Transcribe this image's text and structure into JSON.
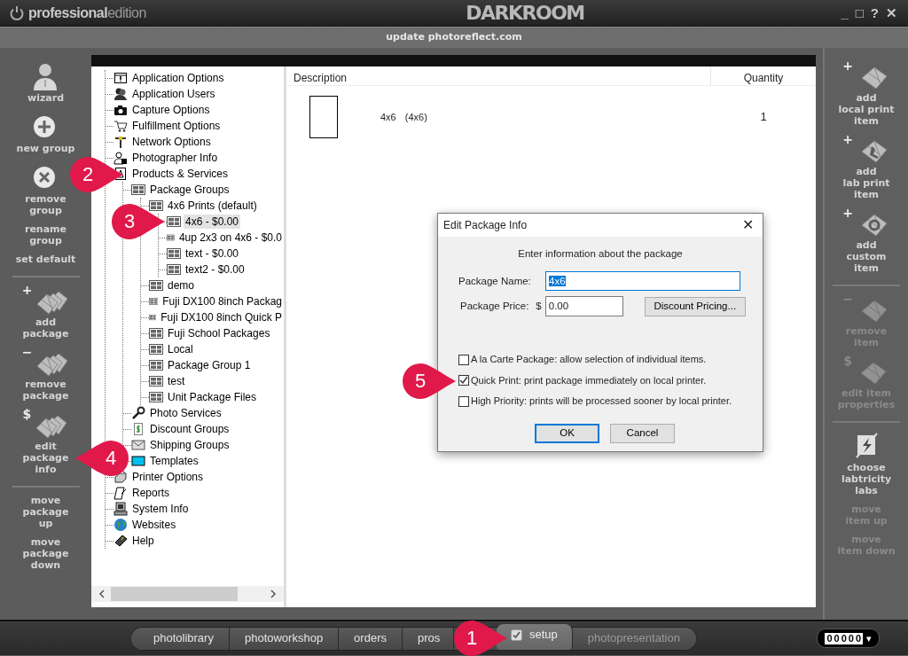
{
  "window": {
    "brand": "professional",
    "edition": "edition",
    "title": "DARKROOM",
    "controls": [
      "_",
      "□",
      "?",
      "✕"
    ]
  },
  "update_bar": {
    "text": "update photoreflect.com"
  },
  "left_toolbar": {
    "groups": [
      [
        {
          "label": "wizard",
          "disabled": false
        },
        {
          "label": "new group",
          "disabled": false
        },
        {
          "label": "remove\ngroup",
          "disabled": false
        },
        {
          "label": "rename\ngroup",
          "disabled": false
        },
        {
          "label": "set default",
          "disabled": false
        }
      ],
      [
        {
          "label": "add\npackage",
          "badge": "+",
          "disabled": false
        },
        {
          "label": "remove\npackage",
          "badge": "−",
          "disabled": false
        },
        {
          "label": "edit\npackage\ninfo",
          "badge": "$",
          "disabled": false
        }
      ],
      [
        {
          "label": "move\npackage\nup",
          "disabled": false
        },
        {
          "label": "move\npackage\ndown",
          "disabled": false
        }
      ]
    ]
  },
  "tree": [
    {
      "label": "Application Options",
      "selected": false
    },
    {
      "label": "Application Users",
      "selected": false
    },
    {
      "label": "Capture Options",
      "selected": false
    },
    {
      "label": "Fulfillment Options",
      "selected": false
    },
    {
      "label": "Network Options",
      "selected": false
    },
    {
      "label": "Photographer Info",
      "selected": false
    },
    {
      "label": "Products & Services",
      "selected": false,
      "children": [
        {
          "label": "Package Groups",
          "selected": false,
          "children": [
            {
              "label": "4x6 Prints (default)",
              "selected": false,
              "children": [
                {
                  "label": "4x6 - $0.00",
                  "selected": true
                },
                {
                  "label": "4up 2x3 on 4x6 - $0.0",
                  "selected": false
                },
                {
                  "label": "text - $0.00",
                  "selected": false
                },
                {
                  "label": "text2 - $0.00",
                  "selected": false
                }
              ]
            },
            {
              "label": "demo",
              "selected": false
            },
            {
              "label": "Fuji DX100 8inch Packag",
              "selected": false
            },
            {
              "label": "Fuji DX100 8inch Quick P",
              "selected": false
            },
            {
              "label": "Fuji School Packages",
              "selected": false
            },
            {
              "label": "Local",
              "selected": false
            },
            {
              "label": "Package Group 1",
              "selected": false
            },
            {
              "label": "test",
              "selected": false
            },
            {
              "label": "Unit Package Files",
              "selected": false
            }
          ]
        },
        {
          "label": "Photo Services",
          "selected": false
        },
        {
          "label": "Discount Groups",
          "selected": false
        },
        {
          "label": "Shipping Groups",
          "selected": false
        },
        {
          "label": "Templates",
          "selected": false
        }
      ]
    },
    {
      "label": "Printer Options",
      "selected": false
    },
    {
      "label": "Reports",
      "selected": false
    },
    {
      "label": "System Info",
      "selected": false
    },
    {
      "label": "Websites",
      "selected": false
    },
    {
      "label": "Help",
      "selected": false
    }
  ],
  "table": {
    "columns": [
      "Description",
      "Quantity"
    ],
    "rows": [
      {
        "name": "4x6",
        "size": "(4x6)",
        "quantity": "1"
      }
    ]
  },
  "dialog": {
    "title": "Edit Package Info",
    "close": "✕",
    "prompt": "Enter information about the package",
    "name_label": "Package Name:",
    "name_value": "4x6",
    "name_value_selected": true,
    "price_label": "Package Price:",
    "currency": "$",
    "price_value": "0.00",
    "pricing_button": "Discount Pricing...",
    "options": [
      {
        "label": "A la Carte Package: allow selection of individual items.",
        "checked": false
      },
      {
        "label": "Quick Print: print package immediately on local printer.",
        "checked": true
      },
      {
        "label": "High Priority: prints will be processed sooner by local printer.",
        "checked": false
      }
    ],
    "buttons": [
      {
        "label": "OK",
        "default": true
      },
      {
        "label": "Cancel",
        "default": false
      }
    ]
  },
  "right_toolbar": {
    "groups": [
      [
        {
          "label": "add\nlocal print\nitem",
          "badge": "+",
          "disabled": false
        },
        {
          "label": "add\nlab print\nitem",
          "badge": "+",
          "disabled": false
        },
        {
          "label": "add\ncustom\nitem",
          "badge": "+",
          "disabled": false
        }
      ],
      [
        {
          "label": "remove\nitem",
          "badge": "−",
          "disabled": true
        },
        {
          "label": "edit item\nproperties",
          "badge": "$",
          "disabled": true
        }
      ],
      [
        {
          "label": "choose\nlabtricity\nlabs",
          "disabled": false
        },
        {
          "label": "move\nitem up",
          "disabled": true
        },
        {
          "label": "move\nitem down",
          "disabled": true
        }
      ]
    ]
  },
  "bottom_tabs": [
    {
      "label": "photolibrary",
      "selected": false,
      "disabled": false
    },
    {
      "label": "photoworkshop",
      "selected": false,
      "disabled": false
    },
    {
      "label": "orders",
      "selected": false,
      "disabled": false
    },
    {
      "label": "pros",
      "selected": false,
      "disabled": false
    },
    {
      "label": "setup",
      "selected": true,
      "disabled": false
    },
    {
      "label": "photopresentation",
      "selected": false,
      "disabled": true
    }
  ],
  "counter": {
    "value": "00000",
    "caret": "▾"
  },
  "callouts": [
    "1",
    "2",
    "3",
    "4",
    "5"
  ]
}
